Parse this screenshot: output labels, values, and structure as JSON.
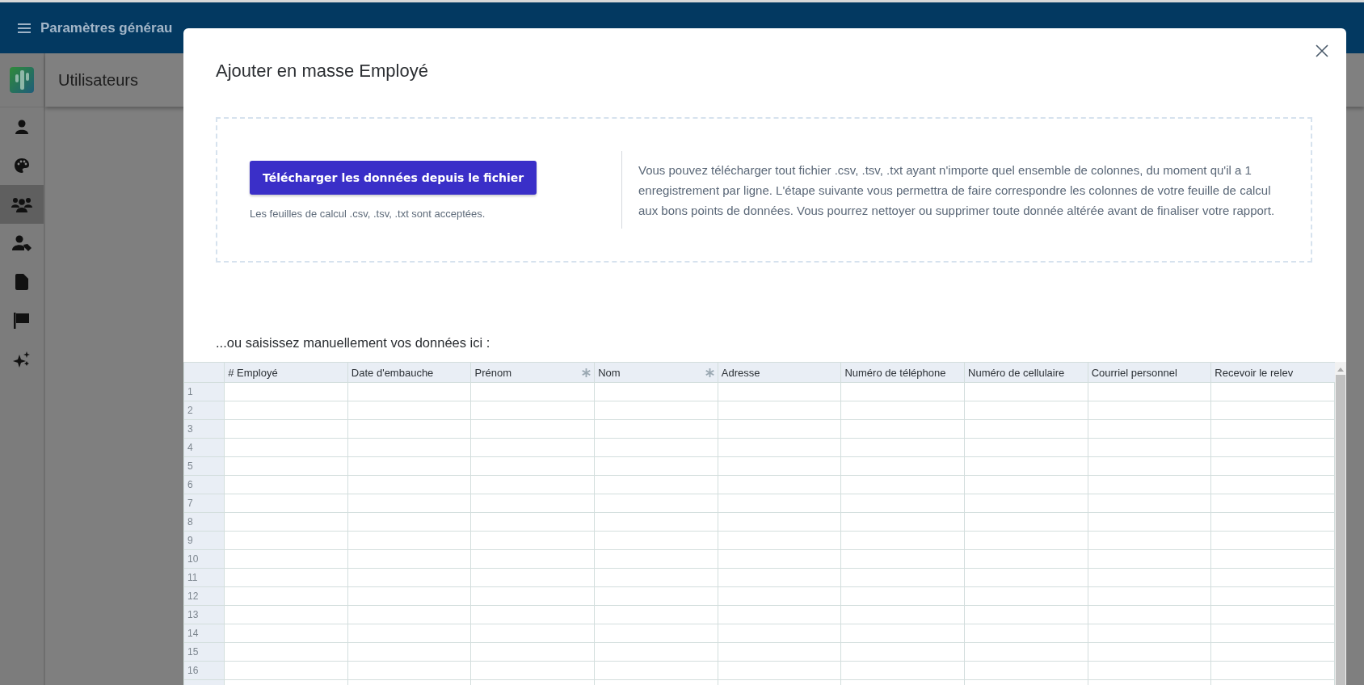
{
  "app_bar": {
    "title": "Paramètres générau"
  },
  "sidebar": {
    "items": [
      {
        "selected": false
      },
      {
        "selected": false
      },
      {
        "selected": true
      },
      {
        "selected": false
      },
      {
        "selected": false
      },
      {
        "selected": false
      },
      {
        "selected": false
      }
    ]
  },
  "page": {
    "title": "Utilisateurs"
  },
  "dialog": {
    "title": "Ajouter en masse Employé",
    "upload_button": "Télécharger les données depuis le fichier",
    "upload_hint": "Les feuilles de calcul .csv, .tsv, .txt sont acceptées.",
    "description": "Vous pouvez télécharger tout fichier .csv, .tsv, .txt ayant n'importe quel ensemble de colonnes, du moment qu'il a 1 enregistrement par ligne. L'étape suivante vous permettra de faire correspondre les colonnes de votre feuille de calcul aux bons points de données. Vous pourrez nettoyer ou supprimer toute donnée altérée avant de finaliser votre rapport.",
    "manual_label": "...ou saisissez manuellement vos données ici :",
    "table": {
      "columns": [
        {
          "label": "# Employé",
          "required": false
        },
        {
          "label": "Date d'embauche",
          "required": false
        },
        {
          "label": "Prénom",
          "required": true
        },
        {
          "label": "Nom",
          "required": true
        },
        {
          "label": "Adresse",
          "required": false
        },
        {
          "label": "Numéro de téléphone",
          "required": false
        },
        {
          "label": "Numéro de cellulaire",
          "required": false
        },
        {
          "label": "Courriel personnel",
          "required": false
        },
        {
          "label": "Recevoir le relev",
          "required": false
        }
      ],
      "rows": [
        "1",
        "2",
        "3",
        "4",
        "5",
        "6",
        "7",
        "8",
        "9",
        "10",
        "11",
        "12",
        "13",
        "14",
        "15",
        "16"
      ]
    }
  }
}
